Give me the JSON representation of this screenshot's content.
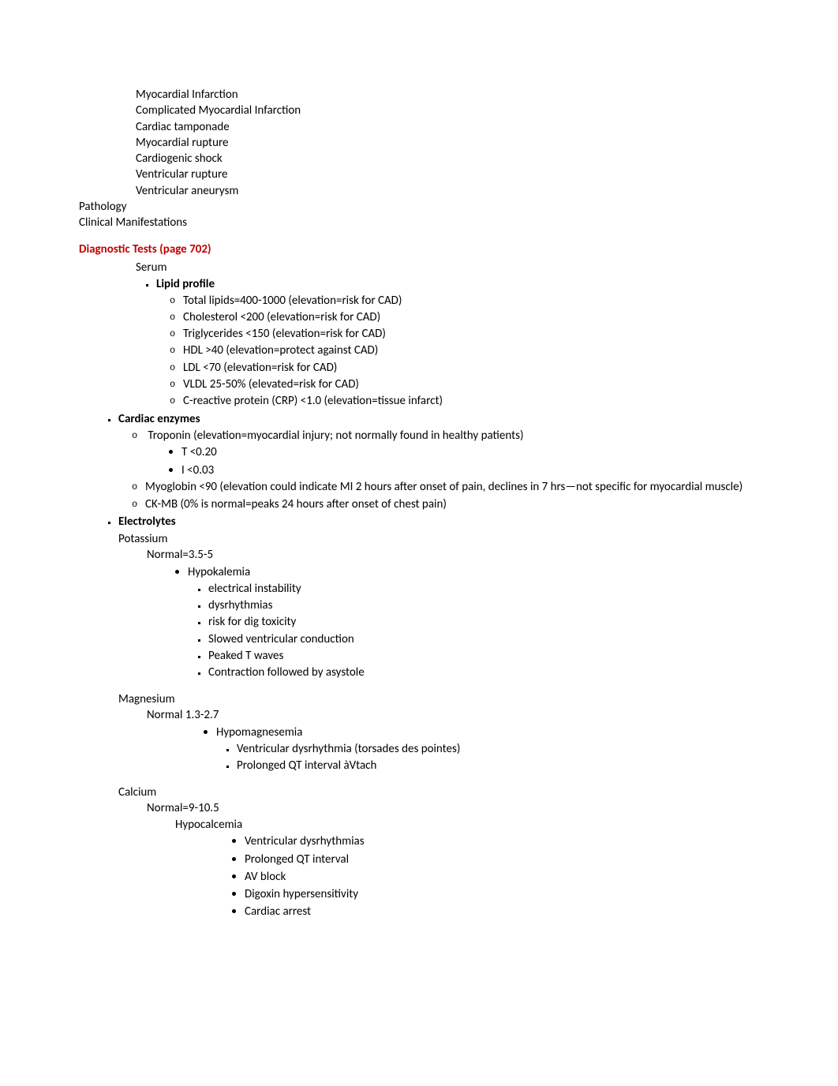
{
  "topConditions": [
    "Myocardial Infarction",
    "Complicated Myocardial Infarction",
    "Cardiac tamponade",
    "Myocardial rupture",
    "Cardiogenic shock",
    "Ventricular rupture",
    "Ventricular aneurysm"
  ],
  "pathology": "Pathology",
  "clinicalManifestations": "Clinical Manifestations",
  "diagnosticTestsHeading": "Diagnostic Tests (page 702)",
  "serum": "Serum",
  "lipidProfile": {
    "label": "Lipid profile",
    "items": [
      "Total lipids=400-1000 (elevation=risk for CAD)",
      "Cholesterol <200 (elevation=risk for CAD)",
      "Triglycerides <150 (elevation=risk for CAD)",
      "HDL >40 (elevation=protect against CAD)",
      "LDL <70 (elevation=risk for CAD)",
      "VLDL 25-50% (elevated=risk for CAD)",
      "C-reactive protein (CRP) <1.0 (elevation=tissue infarct)"
    ]
  },
  "cardiacEnzymes": {
    "label": "Cardiac enzymes",
    "troponin": {
      "text": "Troponin (elevation=myocardial injury; not normally found in healthy patients)",
      "sub": [
        "T <0.20",
        "I <0.03"
      ]
    },
    "myoglobin": "Myoglobin <90 (elevation could indicate MI 2 hours after onset of pain, declines in 7 hrs—not specific for myocardial muscle)",
    "ckmb": "CK-MB (0% is normal=peaks 24 hours after onset of chest pain)"
  },
  "electrolytes": {
    "label": "Electrolytes",
    "potassium": {
      "name": "Potassium",
      "normal": "Normal=3.5-5",
      "condition": "Hypokalemia",
      "effects": [
        "electrical instability",
        "dysrhythmias",
        "risk for dig toxicity",
        "Slowed ventricular conduction",
        "Peaked T waves",
        "Contraction followed by asystole"
      ]
    },
    "magnesium": {
      "name": "Magnesium",
      "normal": "Normal 1.3-2.7",
      "condition": "Hypomagnesemia",
      "effects": [
        "Ventricular dysrhythmia (torsades des pointes)",
        "Prolonged QT interval àVtach"
      ]
    },
    "calcium": {
      "name": "Calcium",
      "normal": "Normal=9-10.5",
      "condition": "Hypocalcemia",
      "effects": [
        "Ventricular dysrhythmias",
        "Prolonged QT interval",
        "AV block",
        "Digoxin hypersensitivity",
        "Cardiac arrest"
      ]
    }
  }
}
